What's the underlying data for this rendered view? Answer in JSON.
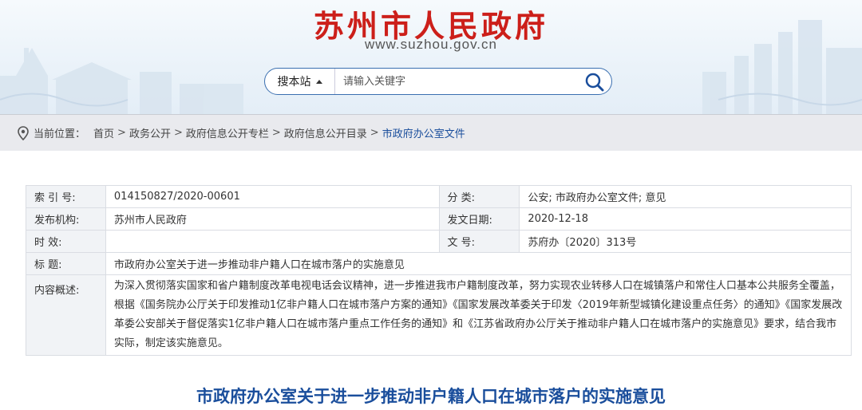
{
  "header": {
    "site_title": "苏州市人民政府",
    "site_url": "www.suzhou.gov.cn",
    "brand_color": "#cc1f1a"
  },
  "search": {
    "scope_label": "搜本站",
    "placeholder": "请输入关键字"
  },
  "breadcrumb": {
    "prefix": "当前位置：",
    "items": [
      "首页",
      "政务公开",
      "政府信息公开专栏",
      "政府信息公开目录",
      "市政府办公室文件"
    ],
    "separator": ">"
  },
  "info": {
    "index_label": "索 引 号:",
    "index_value": "014150827/2020-00601",
    "category_label": "分    类:",
    "category_value": "公安;  市政府办公室文件;  意见",
    "issuer_label": "发布机构:",
    "issuer_value": "苏州市人民政府",
    "date_label": "发文日期:",
    "date_value": "2020-12-18",
    "validity_label": "时    效:",
    "validity_value": "",
    "docno_label": "文    号:",
    "docno_value": "苏府办〔2020〕313号",
    "title_label": "标    题:",
    "title_value": "市政府办公室关于进一步推动非户籍人口在城市落户的实施意见",
    "summary_label": "内容概述:",
    "summary_value": "为深入贯彻落实国家和省户籍制度改革电视电话会议精神，进一步推进我市户籍制度改革，努力实现农业转移人口在城镇落户和常住人口基本公共服务全覆盖，根据《国务院办公厅关于印发推动1亿非户籍人口在城市落户方案的通知》《国家发展改革委关于印发〈2019年新型城镇化建设重点任务〉的通知》《国家发展改革委公安部关于督促落实1亿非户籍人口在城市落户重点工作任务的通知》和《江苏省政府办公厅关于推动非户籍人口在城市落户的实施意见》要求，结合我市实际，制定该实施意见。"
  },
  "document": {
    "title": "市政府办公室关于进一步推动非户籍人口在城市落户的实施意见"
  }
}
